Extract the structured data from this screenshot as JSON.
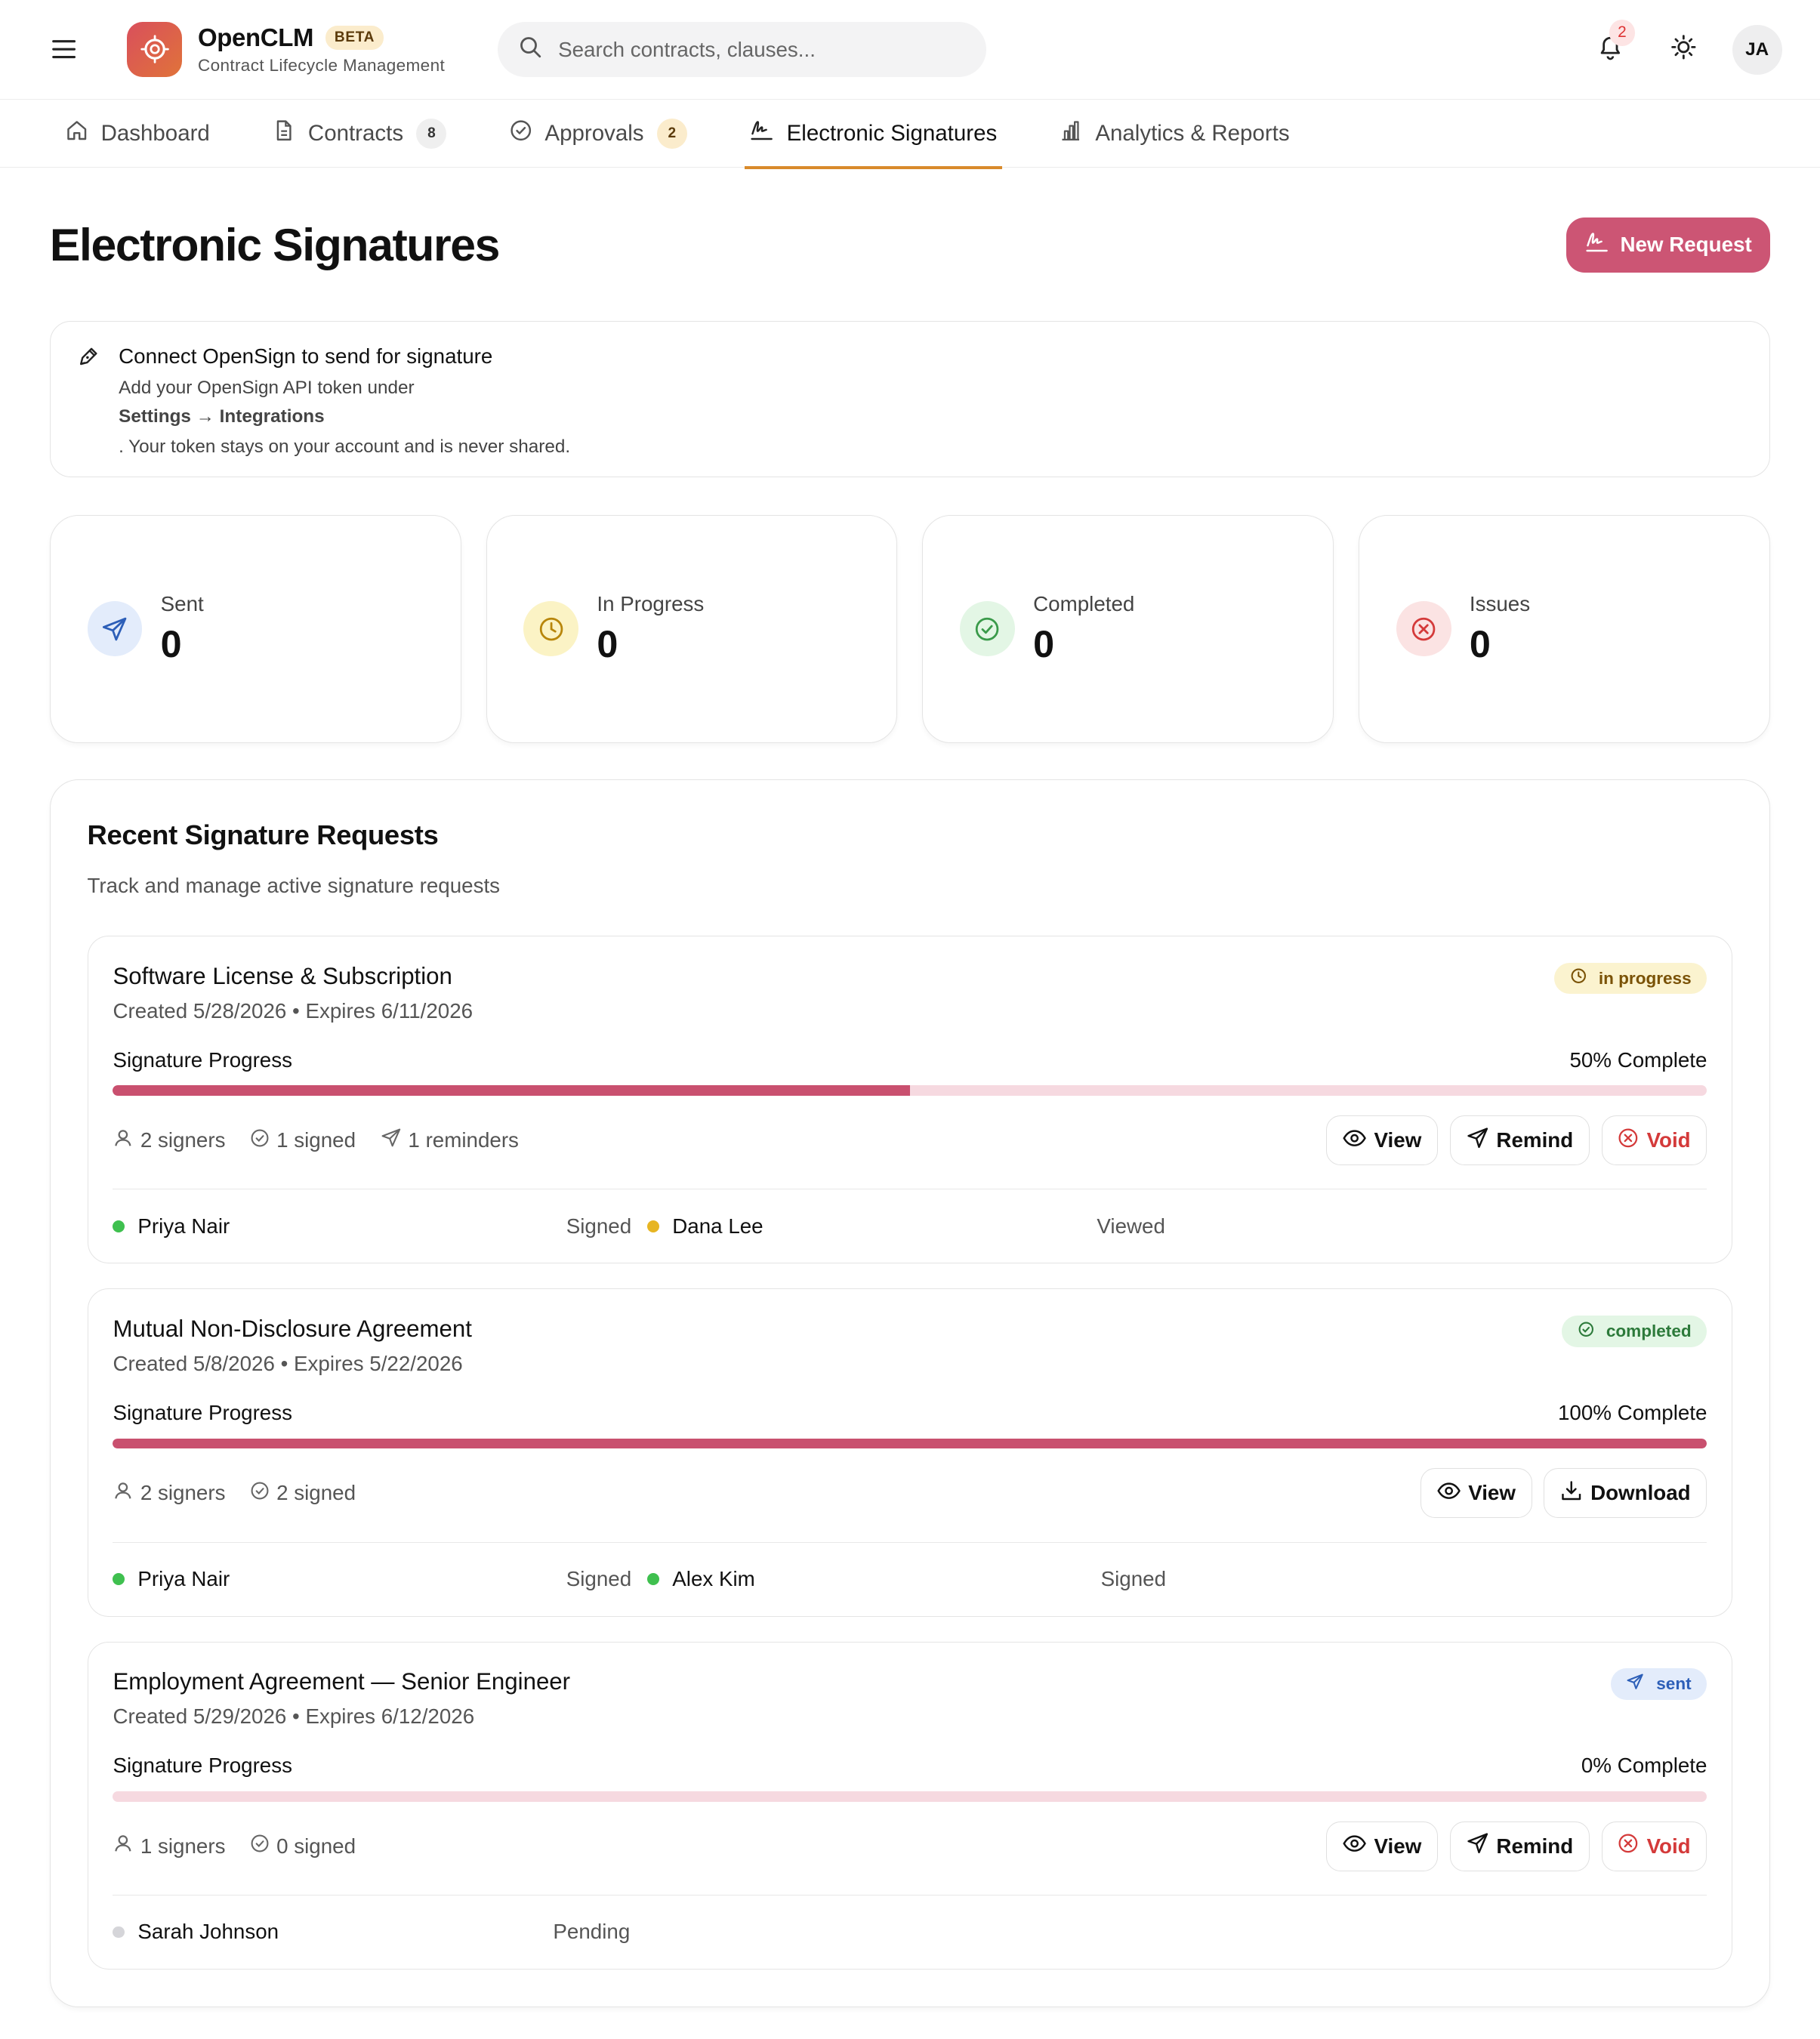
{
  "app": {
    "name": "OpenCLM",
    "badge": "BETA",
    "subtitle": "Contract Lifecycle Management"
  },
  "header": {
    "search_placeholder": "Search contracts, clauses...",
    "notification_count": "2",
    "user_initials": "JA",
    "icons": [
      "menu-icon",
      "logo-icon",
      "search-icon",
      "bell-icon",
      "sun-icon"
    ]
  },
  "nav": {
    "tabs": [
      {
        "label": "Dashboard",
        "icon": "home-icon",
        "active": false
      },
      {
        "label": "Contracts",
        "icon": "document-icon",
        "count": "8",
        "active": false
      },
      {
        "label": "Approvals",
        "icon": "check-circle-icon",
        "count": "2",
        "active": false
      },
      {
        "label": "Electronic Signatures",
        "icon": "signature-icon",
        "active": true
      },
      {
        "label": "Analytics & Reports",
        "icon": "bar-chart-icon",
        "active": false
      }
    ]
  },
  "page": {
    "title": "Electronic Signatures",
    "new_request_label": "New Request"
  },
  "notice": {
    "title": "Connect OpenSign to send for signature",
    "line1": "Add your OpenSign API token under",
    "path": "Settings → Integrations",
    "line2": ". Your token stays on your account and is never shared."
  },
  "stats": [
    {
      "label": "Sent",
      "value": "0",
      "icon": "send-icon"
    },
    {
      "label": "In Progress",
      "value": "0",
      "icon": "clock-icon"
    },
    {
      "label": "Completed",
      "value": "0",
      "icon": "check-circle-icon"
    },
    {
      "label": "Issues",
      "value": "0",
      "icon": "x-circle-icon"
    }
  ],
  "recent": {
    "title": "Recent Signature Requests",
    "subtitle": "Track and manage active signature requests",
    "progress_label": "Signature Progress",
    "requests": [
      {
        "title": "Software License & Subscription",
        "meta": "Created 5/28/2026 • Expires 6/11/2026",
        "status": "in progress",
        "progress_text": "50% Complete",
        "progress": 0.5,
        "signers_text": "2 signers",
        "signed_text": "1 signed",
        "reminders_text": "1 reminders",
        "actions": [
          "View",
          "Remind",
          "Void"
        ],
        "signers": [
          {
            "name": "Priya Nair",
            "state": "Signed"
          },
          {
            "name": "Dana Lee",
            "state": "Viewed"
          }
        ]
      },
      {
        "title": "Mutual Non-Disclosure Agreement",
        "meta": "Created 5/8/2026 • Expires 5/22/2026",
        "status": "completed",
        "progress_text": "100% Complete",
        "progress": 1.0,
        "signers_text": "2 signers",
        "signed_text": "2 signed",
        "actions": [
          "View",
          "Download"
        ],
        "signers": [
          {
            "name": "Priya Nair",
            "state": "Signed"
          },
          {
            "name": "Alex Kim",
            "state": "Signed"
          }
        ]
      },
      {
        "title": "Employment Agreement — Senior Engineer",
        "meta": "Created 5/29/2026 • Expires 6/12/2026",
        "status": "sent",
        "progress_text": "0% Complete",
        "progress": 0,
        "signers_text": "1 signers",
        "signed_text": "0 signed",
        "actions": [
          "View",
          "Remind",
          "Void"
        ],
        "signers": [
          {
            "name": "Sarah Johnson",
            "state": "Pending"
          }
        ]
      }
    ]
  },
  "colors": {
    "accent": "#cc5574",
    "tab_underline": "#d98a2b",
    "signed_dot": "#3fc04f",
    "viewed_dot": "#e7b523",
    "pending_dot": "#d5d5d9"
  }
}
